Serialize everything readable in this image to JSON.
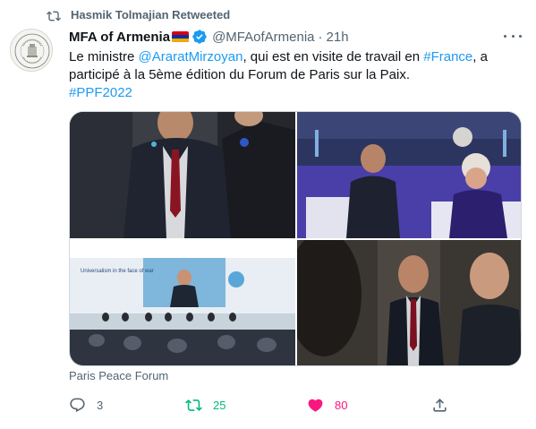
{
  "retweet_banner": {
    "text": "Hasmik Tolmajian Retweeted",
    "icon": "retweet-icon"
  },
  "author": {
    "name": "MFA of Armenia",
    "flag_colors": [
      "#d90012",
      "#0033a0",
      "#f2a800"
    ],
    "verified": true,
    "handle": "@MFAofArmenia",
    "separator": "·",
    "time": "21h",
    "avatar_icon": "ministry-seal-logo"
  },
  "tweet": {
    "part1": "Le ministre ",
    "mention": "@AraratMirzoyan",
    "part2": ", qui est en visite de travail en ",
    "hashtag_france": "#France",
    "part3": ", a participé à la 5ème édition du Forum de Paris sur la Paix.",
    "hashtag_ppf": "#PPF2022"
  },
  "media": {
    "caption": "Paris Peace Forum",
    "screen_title": "Universalism in the face of war"
  },
  "actions": {
    "reply_count": "3",
    "retweet_count": "25",
    "like_count": "80"
  },
  "colors": {
    "text": "#0f1419",
    "muted": "#536471",
    "link": "#1d9bf0",
    "retweet": "#00ba7c",
    "like": "#f91880",
    "verified": "#1d9bf0"
  }
}
